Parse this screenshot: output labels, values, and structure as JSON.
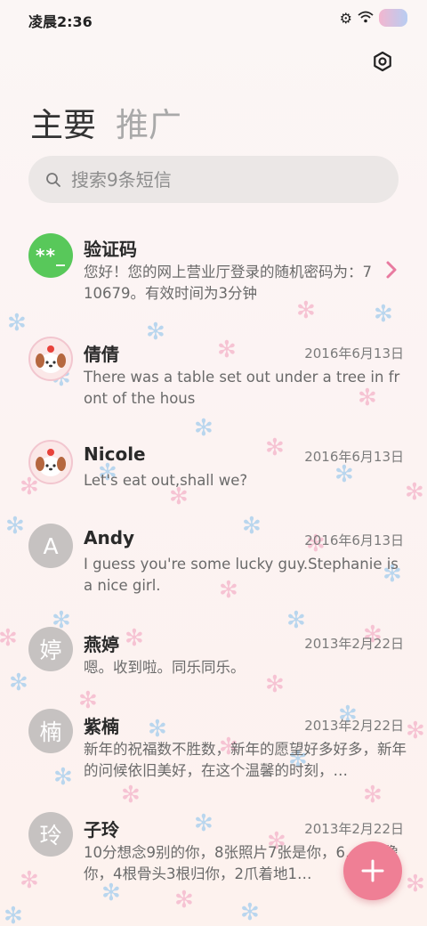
{
  "status_bar": {
    "time": "凌晨2:36"
  },
  "tabs": [
    {
      "label": "主要"
    },
    {
      "label": "推广"
    }
  ],
  "search": {
    "placeholder": "搜索9条短信"
  },
  "threads": [
    {
      "name": "验证码",
      "avatar": "**_",
      "date": "",
      "preview": "您好！您的网上营业厅登录的随机密码为：710679。有效时间为3分钟"
    },
    {
      "name": "倩倩",
      "avatar": "puppy-sticker",
      "date": "2016年6月13日",
      "preview": "There was a table set out under a tree in front of the hous"
    },
    {
      "name": "Nicole",
      "avatar": "puppy-sticker",
      "date": "2016年6月13日",
      "preview": "Let's eat out,shall we?"
    },
    {
      "name": "Andy",
      "avatar": "A",
      "date": "2016年6月13日",
      "preview": "I guess you're some lucky guy.Stephanie is a nice girl."
    },
    {
      "name": "燕婷",
      "avatar": "婷",
      "date": "2013年2月22日",
      "preview": "嗯。收到啦。同乐同乐。"
    },
    {
      "name": "紫楠",
      "avatar": "楠",
      "date": "2013年2月22日",
      "preview": "新年的祝福数不胜数，新年的愿望好多好多，新年的问候依旧美好，在这个温馨的时刻，…"
    },
    {
      "name": "子玲",
      "avatar": "玲",
      "date": "2013年2月22日",
      "preview": "10分想念9别的你，8张照片7张是你，6…5只像你，4根骨头3根归你，2爪着地1…"
    }
  ],
  "colors": {
    "fab": "#ef7f95",
    "verify_avatar": "#58c85a",
    "letter_avatar": "#c6c2c1",
    "chevron": "#e87aa0"
  },
  "icons": {
    "settings": "gear-icon",
    "search": "search-icon",
    "fab": "plus-icon",
    "open_thread": "chevron-right-icon"
  }
}
